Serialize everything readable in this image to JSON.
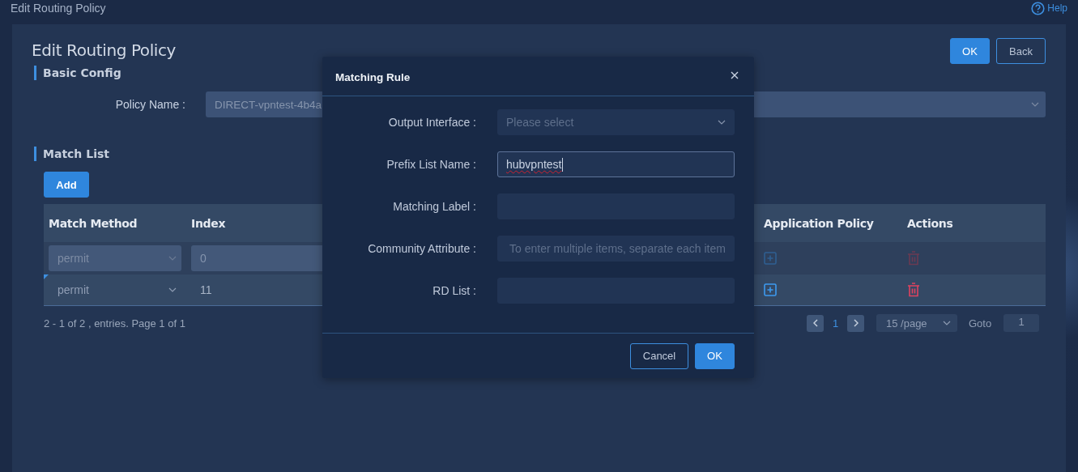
{
  "header": {
    "title": "Edit Routing Policy",
    "help": "Help"
  },
  "page": {
    "title": "Edit Routing Policy",
    "buttons": [
      {
        "label": "OK",
        "kind": "primary"
      },
      {
        "label": "Back",
        "kind": "secondary"
      }
    ]
  },
  "basic_config": {
    "heading": "Basic Config",
    "fields": [
      {
        "label": "Policy Name :",
        "value": "DIRECT-vpntest-4b4a",
        "disabled": true
      }
    ]
  },
  "match_list": {
    "heading": "Match List",
    "add_button": "Add",
    "columns": [
      "Match Method",
      "Index",
      "Application Policy",
      "Actions"
    ],
    "rows": [
      {
        "match_method": "permit",
        "index": "0",
        "disabled": true,
        "modified": false
      },
      {
        "match_method": "permit",
        "index": "11",
        "disabled": false,
        "modified": true
      }
    ],
    "summary": "2 - 1 of 2 , entries. Page 1 of 1",
    "pagination": {
      "page": "1",
      "page_size": "15 /page",
      "goto_label": "Goto",
      "goto_value": "1"
    }
  },
  "dialog": {
    "title": "Matching Rule",
    "fields": [
      {
        "label": "Output Interface :",
        "kind": "select",
        "placeholder": "Please select",
        "focused": false
      },
      {
        "label": "Prefix List Name :",
        "kind": "input",
        "value": "hubvpntest",
        "focused": true
      },
      {
        "label": "Matching Label :",
        "kind": "input",
        "focused": false
      },
      {
        "label": "Community Attribute :",
        "kind": "input",
        "placeholder": "To enter multiple items, separate each item",
        "focused": false
      },
      {
        "label": "RD List :",
        "kind": "input",
        "focused": false
      }
    ],
    "buttons": [
      {
        "label": "Cancel",
        "kind": "secondary"
      },
      {
        "label": "OK",
        "kind": "primary"
      }
    ]
  }
}
